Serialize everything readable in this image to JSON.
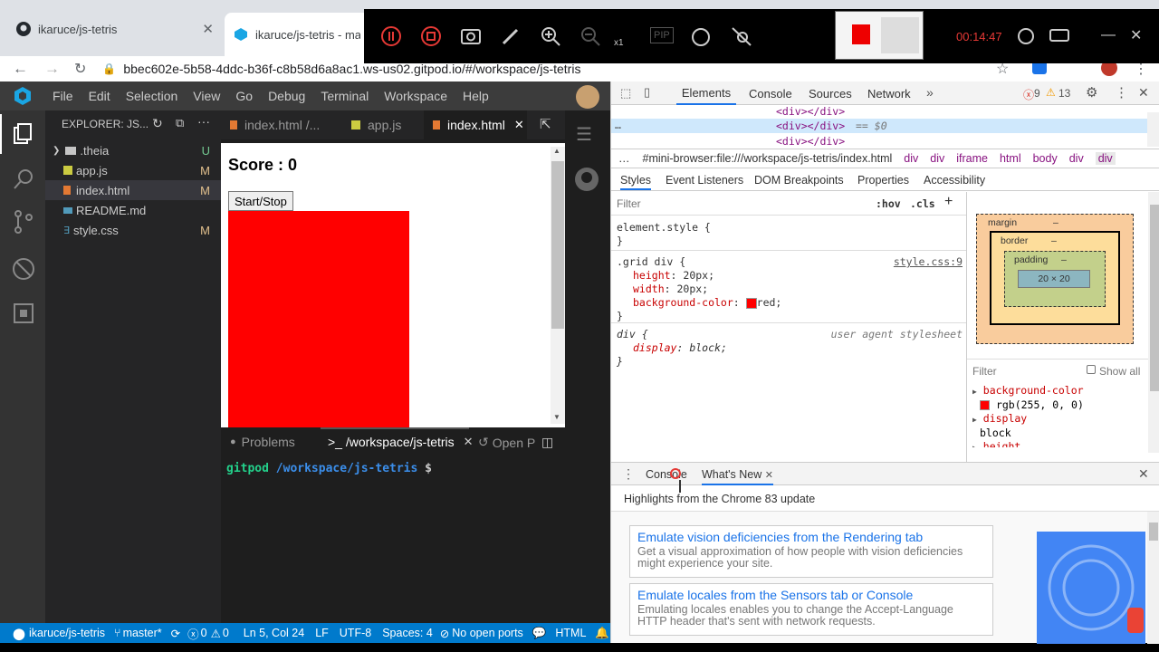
{
  "browser": {
    "tabs": [
      {
        "title": "ikaruce/js-tetris",
        "icon": "github-icon"
      },
      {
        "title": "ikaruce/js-tetris - mas",
        "icon": "gitpod-icon"
      }
    ],
    "url": "bbec602e-5b58-4ddc-b36f-c8b58d6a8ac1.ws-us02.gitpod.io/#/workspace/js-tetris"
  },
  "recorder": {
    "zoom": "x1",
    "pip": "PIP",
    "timer": "00:14:47"
  },
  "ide": {
    "menu": [
      "File",
      "Edit",
      "Selection",
      "View",
      "Go",
      "Debug",
      "Terminal",
      "Workspace",
      "Help"
    ],
    "explorer": {
      "title": "EXPLORER: JS...",
      "items": [
        {
          "name": ".theia",
          "badge": "U",
          "type": "folder"
        },
        {
          "name": "app.js",
          "badge": "M",
          "type": "js"
        },
        {
          "name": "index.html",
          "badge": "M",
          "type": "html"
        },
        {
          "name": "README.md",
          "badge": "",
          "type": "md"
        },
        {
          "name": "style.css",
          "badge": "M",
          "type": "css"
        }
      ]
    },
    "editor_tabs": [
      {
        "label": "index.html /..."
      },
      {
        "label": "app.js"
      },
      {
        "label": "index.html"
      }
    ],
    "preview": {
      "score_label": "Score : 0",
      "button_label": "Start/Stop",
      "block_color": "#ff0000"
    },
    "panel": {
      "tabs": [
        "Problems",
        ">_ /workspace/js-tetris",
        "Open Pr"
      ],
      "prompt_user": "gitpod",
      "prompt_path": "/workspace/js-tetris",
      "prompt_symbol": "$"
    },
    "status": {
      "repo": "ikaruce/js-tetris",
      "branch": "master*",
      "errors": "0",
      "warnings": "0",
      "position": "Ln 5, Col 24",
      "eol": "LF",
      "encoding": "UTF-8",
      "spaces": "Spaces: 4",
      "ports": "No open ports",
      "language": "HTML"
    }
  },
  "devtools": {
    "tabs": [
      "Elements",
      "Console",
      "Sources",
      "Network"
    ],
    "error_count": "9",
    "warning_count": "13",
    "dom_lines": [
      "<div></div>",
      "<div></div>",
      "== $0",
      "<div></div>"
    ],
    "breadcrumbs": [
      "#mini-browser:file:///workspace/js-tetris/index.html",
      "div",
      "div",
      "iframe",
      "html",
      "body",
      "div",
      "div"
    ],
    "subtabs": [
      "Styles",
      "Event Listeners",
      "DOM Breakpoints",
      "Properties",
      "Accessibility"
    ],
    "filter_placeholder": "Filter",
    "hov": ":hov",
    "cls": ".cls",
    "rules": {
      "element_style": "element.style {",
      "grid_selector": ".grid div {",
      "grid_source": "style.css:9",
      "grid_props": [
        {
          "name": "height",
          "value": "20px;"
        },
        {
          "name": "width",
          "value": "20px;"
        },
        {
          "name": "background-color",
          "value": "red;"
        }
      ],
      "div_selector": "div {",
      "div_source": "user agent stylesheet",
      "div_prop": {
        "name": "display",
        "value": "block;"
      }
    },
    "boxmodel": {
      "margin": "margin",
      "border": "border",
      "padding": "padding",
      "dash": "–",
      "content": "20 × 20"
    },
    "computed": {
      "filter": "Filter",
      "show_all": "Show all",
      "items": [
        {
          "name": "background-color",
          "value": "rgb(255, 0, 0)"
        },
        {
          "name": "display",
          "value": "block"
        },
        {
          "name": "height",
          "value": ""
        }
      ]
    },
    "drawer": {
      "tabs": [
        "Console",
        "What's New"
      ],
      "headline": "Highlights from the Chrome 83 update",
      "cards": [
        {
          "title": "Emulate vision deficiencies from the Rendering tab",
          "desc": "Get a visual approximation of how people with vision deficiencies might experience your site."
        },
        {
          "title": "Emulate locales from the Sensors tab or Console",
          "desc": "Emulating locales enables you to change the Accept-Language HTTP header that's sent with network requests."
        }
      ]
    }
  }
}
